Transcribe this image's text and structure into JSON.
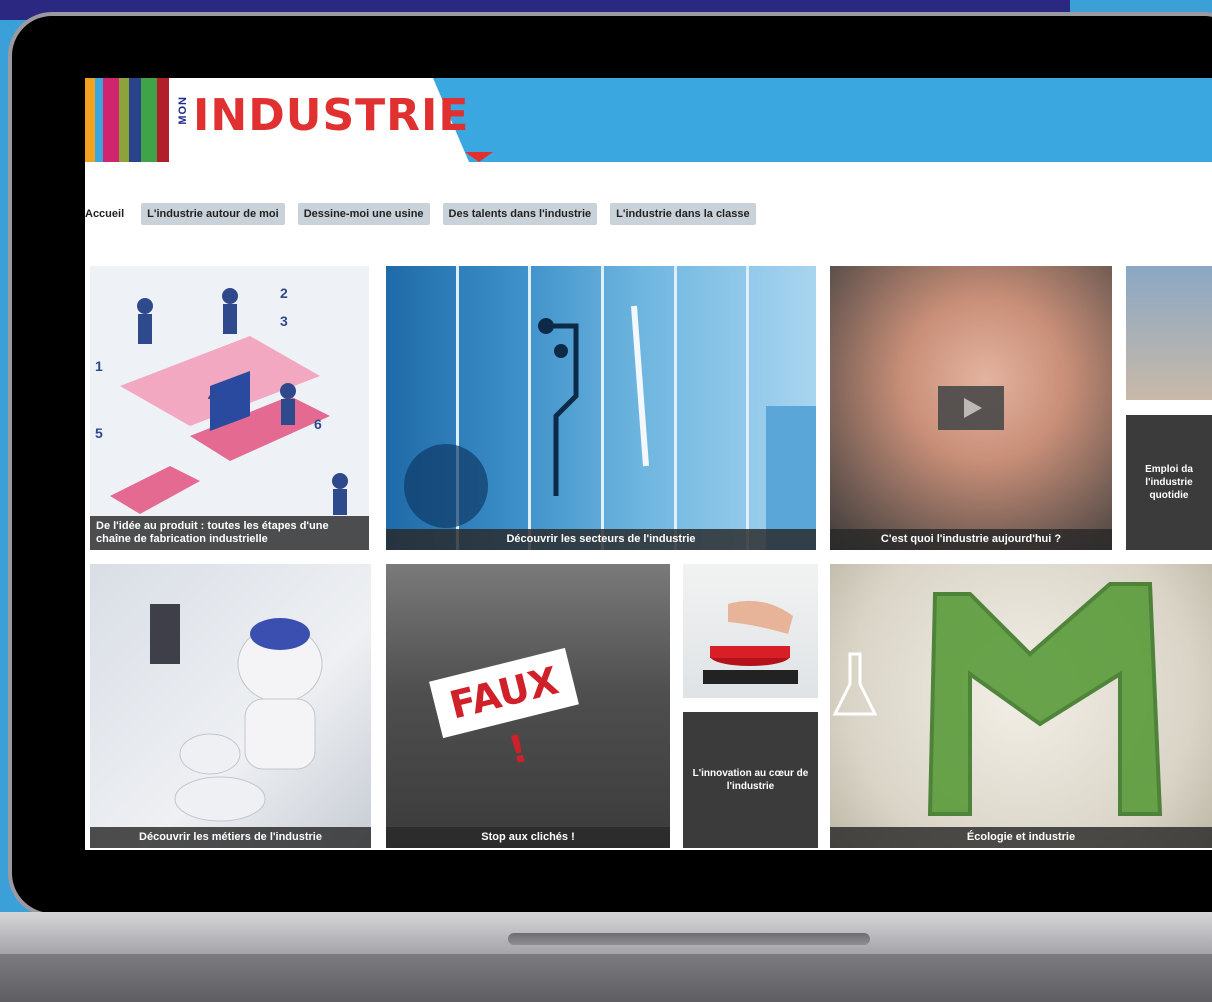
{
  "logo": {
    "mon": "MON",
    "industrie": "INDUSTRIE"
  },
  "nav": {
    "items": [
      "Accueil",
      "L'industrie autour de moi",
      "Dessine-moi une usine",
      "Des talents dans l'industrie",
      "L'industrie dans la classe"
    ]
  },
  "tiles": {
    "etapes": "De l'idée au produit : toutes les étapes d'une chaîne de fabrication industrielle",
    "secteurs": "Découvrir les secteurs de l'industrie",
    "video": "C'est quoi l'industrie aujourd'hui ?",
    "emploi": "Emploi da l'industrie quotidie",
    "metiers": "Découvrir les métiers de l'industrie",
    "cliches": "Stop aux clichés !",
    "faux": "FAUX !",
    "innovation": "L'innovation au cœur de l'industrie",
    "ecologie": "Écologie et industrie"
  },
  "colors": {
    "header": "#3aa7e0",
    "logo_red": "#e0302f",
    "logo_blue": "#1d2b8a",
    "background": "#2a2880"
  },
  "icons": [
    "play-icon"
  ]
}
